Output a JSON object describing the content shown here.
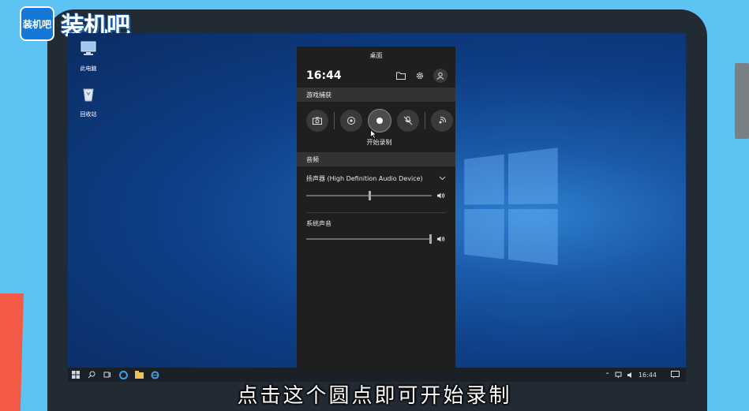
{
  "logo": {
    "badge_text": "装机吧",
    "text": "装机吧"
  },
  "desktop": {
    "icons": [
      {
        "label": "此电脑",
        "icon": "computer-icon"
      },
      {
        "label": "回收站",
        "icon": "recycle-bin-icon"
      }
    ]
  },
  "game_bar": {
    "title": "桌面",
    "clock": "16:44",
    "capture_section": "游戏捕获",
    "record_label": "开始录制",
    "audio_section": "音频",
    "audio_device": "扬声器 (High Definition Audio Device)",
    "device_volume": 0.5,
    "system_sound_label": "系统声音",
    "system_volume": 1.0,
    "icons": [
      "folder-icon",
      "gear-icon",
      "user-icon",
      "camera-icon",
      "replay-icon",
      "record-icon",
      "mic-off-icon",
      "broadcast-icon",
      "volume-icon"
    ]
  },
  "taskbar": {
    "time": "16:44",
    "icons": [
      "windows-start-icon",
      "search-icon",
      "task-view-icon",
      "edge-icon",
      "file-explorer-icon",
      "ie-icon",
      "chevron-up-icon",
      "network-icon",
      "speaker-icon",
      "notification-icon"
    ]
  },
  "subtitle": "点击这个圆点即可开始录制",
  "colors": {
    "accent": "#5dc3f2",
    "panel": "#1f1f1f",
    "red": "#f25a45"
  }
}
